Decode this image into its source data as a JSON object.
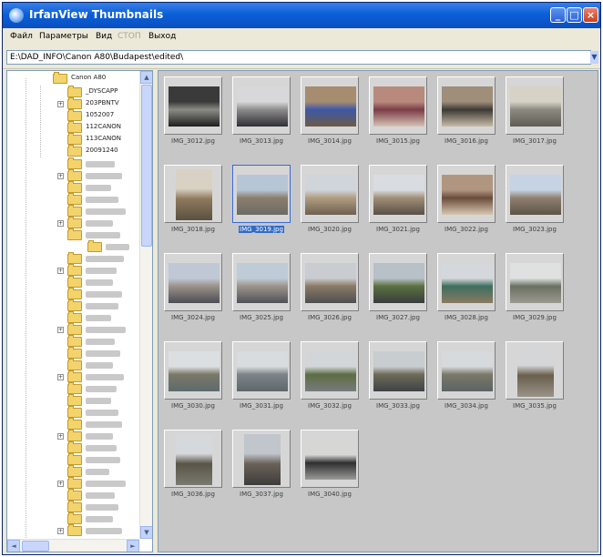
{
  "window": {
    "title": "IrfanView Thumbnails"
  },
  "titlebar_buttons": {
    "minimize": "_",
    "maximize": "□",
    "close": "×"
  },
  "menu": [
    {
      "label": "Файл",
      "disabled": false
    },
    {
      "label": "Параметры",
      "disabled": false
    },
    {
      "label": "Вид",
      "disabled": false
    },
    {
      "label": "СТОП",
      "disabled": true
    },
    {
      "label": "Выход",
      "disabled": false
    }
  ],
  "address": {
    "value": "E:\\DAD_INFO\\Canon A80\\Budapest\\edited\\"
  },
  "tree": {
    "folders": [
      {
        "label": "Canon A80",
        "depth": 0,
        "expandable": false
      },
      {
        "label": "_DYSCAPP",
        "depth": 1,
        "expandable": false
      },
      {
        "label": "203PBNTV",
        "depth": 1,
        "expandable": true
      },
      {
        "label": "1052007",
        "depth": 1,
        "expandable": false
      },
      {
        "label": "112CANON",
        "depth": 1,
        "expandable": false
      },
      {
        "label": "113CANON",
        "depth": 1,
        "expandable": false
      },
      {
        "label": "20091240",
        "depth": 1,
        "expandable": false
      }
    ]
  },
  "thumbnails": [
    {
      "filename": "IMG_3012.jpg",
      "colors": [
        "#3a3a3a",
        "#8b8b86",
        "#1e1e1e"
      ],
      "portrait": false,
      "selected": false
    },
    {
      "filename": "IMG_3013.jpg",
      "colors": [
        "#d8d8da",
        "#8c8c8c",
        "#2f3036"
      ],
      "portrait": false,
      "selected": false
    },
    {
      "filename": "IMG_3014.jpg",
      "colors": [
        "#a68d70",
        "#3d58a8",
        "#6e5a46"
      ],
      "portrait": false,
      "selected": false
    },
    {
      "filename": "IMG_3015.jpg",
      "colors": [
        "#b88a7e",
        "#7b3d46",
        "#d6c2b4"
      ],
      "portrait": false,
      "selected": false
    },
    {
      "filename": "IMG_3016.jpg",
      "colors": [
        "#9e8e7a",
        "#3d3a34",
        "#c8bca8"
      ],
      "portrait": false,
      "selected": false
    },
    {
      "filename": "IMG_3017.jpg",
      "colors": [
        "#d7d2c6",
        "#8c8a80",
        "#5e5c54"
      ],
      "portrait": false,
      "selected": false
    },
    {
      "filename": "IMG_3018.jpg",
      "colors": [
        "#d9d2c4",
        "#8f7a5c",
        "#5a5040"
      ],
      "portrait": true,
      "selected": false
    },
    {
      "filename": "IMG_3019.jpg",
      "colors": [
        "#b7c6d6",
        "#8c7e6c",
        "#6b6b66"
      ],
      "portrait": false,
      "selected": true
    },
    {
      "filename": "IMG_3020.jpg",
      "colors": [
        "#cfd5db",
        "#b09c80",
        "#6e6050"
      ],
      "portrait": false,
      "selected": false
    },
    {
      "filename": "IMG_3021.jpg",
      "colors": [
        "#d9dde2",
        "#a08e76",
        "#5a5046"
      ],
      "portrait": false,
      "selected": false
    },
    {
      "filename": "IMG_3022.jpg",
      "colors": [
        "#b09680",
        "#6a4c3c",
        "#d8c6b0"
      ],
      "portrait": false,
      "selected": false
    },
    {
      "filename": "IMG_3023.jpg",
      "colors": [
        "#c6d3e4",
        "#8e8070",
        "#5e5446"
      ],
      "portrait": false,
      "selected": false
    },
    {
      "filename": "IMG_3024.jpg",
      "colors": [
        "#c0c8d6",
        "#9a928a",
        "#4c4c52"
      ],
      "portrait": false,
      "selected": false
    },
    {
      "filename": "IMG_3025.jpg",
      "colors": [
        "#c0cbd8",
        "#9c948a",
        "#505058"
      ],
      "portrait": false,
      "selected": false
    },
    {
      "filename": "IMG_3026.jpg",
      "colors": [
        "#c9ccd0",
        "#8a7a66",
        "#4e4e50"
      ],
      "portrait": false,
      "selected": false
    },
    {
      "filename": "IMG_3027.jpg",
      "colors": [
        "#b8c0c8",
        "#5a7040",
        "#3a3c3e"
      ],
      "portrait": false,
      "selected": false
    },
    {
      "filename": "IMG_3028.jpg",
      "colors": [
        "#d4d8dc",
        "#3e6e5e",
        "#8a7a62"
      ],
      "portrait": false,
      "selected": false
    },
    {
      "filename": "IMG_3029.jpg",
      "colors": [
        "#dfe0e0",
        "#6a7060",
        "#9a9a90"
      ],
      "portrait": false,
      "selected": false
    },
    {
      "filename": "IMG_3030.jpg",
      "colors": [
        "#dcdfe2",
        "#7a7866",
        "#5e6a6e"
      ],
      "portrait": false,
      "selected": false
    },
    {
      "filename": "IMG_3031.jpg",
      "colors": [
        "#d8dcde",
        "#7c8488",
        "#5e686c"
      ],
      "portrait": false,
      "selected": false
    },
    {
      "filename": "IMG_3032.jpg",
      "colors": [
        "#d2d6d8",
        "#5e6c44",
        "#767c7e"
      ],
      "portrait": false,
      "selected": false
    },
    {
      "filename": "IMG_3033.jpg",
      "colors": [
        "#c8cdd0",
        "#6e6a58",
        "#3e4246"
      ],
      "portrait": false,
      "selected": false
    },
    {
      "filename": "IMG_3034.jpg",
      "colors": [
        "#d6dadc",
        "#7a7868",
        "#5c6466"
      ],
      "portrait": false,
      "selected": false
    },
    {
      "filename": "IMG_3035.jpg",
      "colors": [
        "#d4d6d8",
        "#6a5e4c",
        "#9a9488"
      ],
      "portrait": true,
      "selected": false
    },
    {
      "filename": "IMG_3036.jpg",
      "colors": [
        "#d6d9dc",
        "#5a5448",
        "#7a7a6e"
      ],
      "portrait": true,
      "selected": false
    },
    {
      "filename": "IMG_3037.jpg",
      "colors": [
        "#c0c6cc",
        "#6a625a",
        "#3e3c3a"
      ],
      "portrait": true,
      "selected": false
    },
    {
      "filename": "IMG_3040.jpg",
      "colors": [
        "#d6d6d4",
        "#2e2e30",
        "#9a9a98"
      ],
      "portrait": false,
      "selected": false
    }
  ]
}
